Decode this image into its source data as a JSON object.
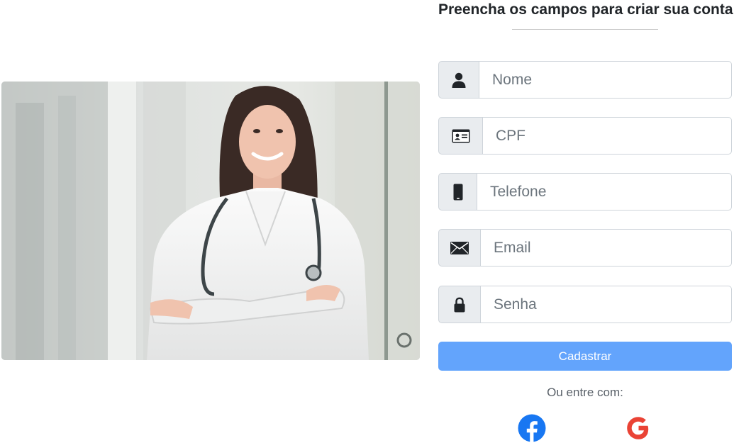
{
  "form": {
    "title": "Preencha os campos para criar sua conta",
    "fields": [
      {
        "placeholder": "Nome",
        "icon": "user-icon"
      },
      {
        "placeholder": "CPF",
        "icon": "id-card-icon"
      },
      {
        "placeholder": "Telefone",
        "icon": "mobile-phone-icon"
      },
      {
        "placeholder": "Email",
        "icon": "envelope-icon"
      },
      {
        "placeholder": "Senha",
        "icon": "lock-icon"
      }
    ],
    "submit_label": "Cadastrar",
    "alt_login_text": "Ou entre com:"
  },
  "social": [
    {
      "icon": "facebook-icon",
      "color": "#1877f2"
    },
    {
      "icon": "google-icon",
      "color": "#ea4335"
    }
  ],
  "photo": {
    "subject": "doctor-photo"
  },
  "colors": {
    "button": "#63a4fc",
    "addon_bg": "#e9ecef",
    "border": "#ced4da"
  }
}
